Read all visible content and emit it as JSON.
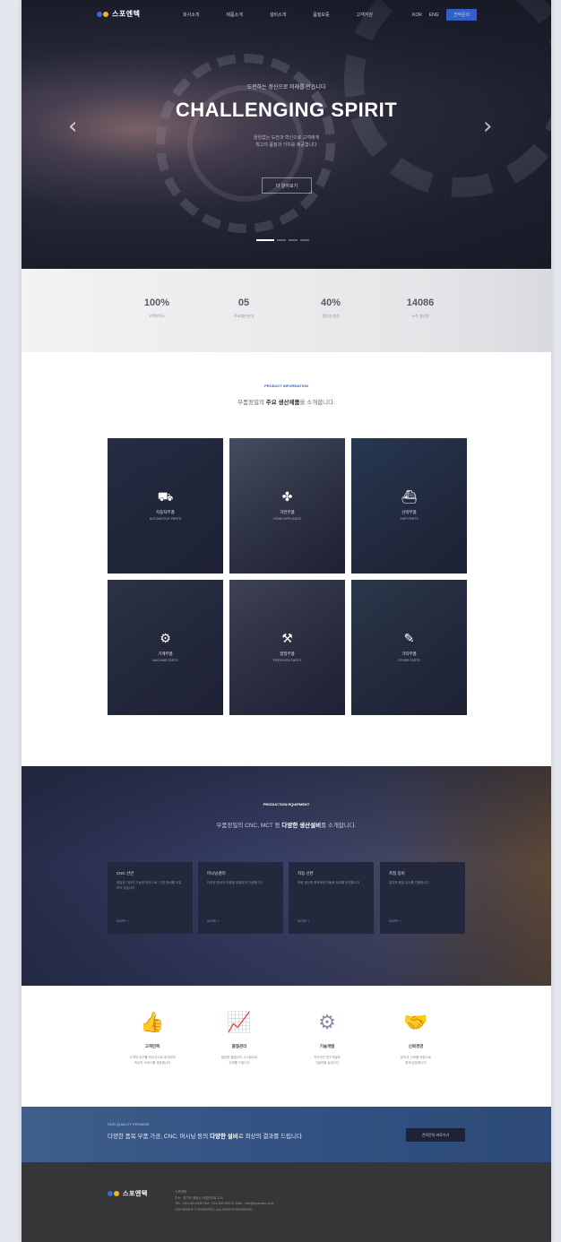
{
  "nav": {
    "logo_text": "스포엔텍",
    "menu": [
      "회사소개",
      "제품소개",
      "설비소개",
      "품질보증",
      "고객지원"
    ],
    "lang": "KOR",
    "lang_alt": "ENG",
    "cta_label": "견적문의"
  },
  "hero": {
    "subtitle": "도전하는 정신으로 미래를 만듭니다",
    "title": "CHALLENGING SPIRIT",
    "description_line1": "끊임없는 도전과 혁신으로 고객에게",
    "description_line2": "최고의 품질과 가치를 제공합니다",
    "button_label": "더 알아보기",
    "slide_count": 4,
    "active_slide": 1
  },
  "stats": [
    {
      "value": "100%",
      "label": "고객만족도"
    },
    {
      "value": "05",
      "label": "주요생산분야"
    },
    {
      "value": "40%",
      "label": "생산성 향상"
    },
    {
      "value": "14086",
      "label": "누적 생산량"
    }
  ],
  "products": {
    "eyebrow": "PRODUCT INFORMATION",
    "title_prefix": "부품정밀의 ",
    "title_bold": "주요 생산제품",
    "title_suffix": "을 소개합니다.",
    "items": [
      {
        "label": "자동차부품",
        "sub": "AUTOMOTIVE PARTS",
        "icon": "car-icon",
        "glyph": "⛟"
      },
      {
        "label": "가전부품",
        "sub": "HOME APPLIANCE",
        "icon": "appliance-icon",
        "glyph": "✤"
      },
      {
        "label": "선박부품",
        "sub": "SHIP PARTS",
        "icon": "ship-icon",
        "glyph": "⛴"
      },
      {
        "label": "기계부품",
        "sub": "MACHINE PARTS",
        "icon": "machine-icon",
        "glyph": "⚙"
      },
      {
        "label": "정밀부품",
        "sub": "PRECISION PARTS",
        "icon": "precision-icon",
        "glyph": "⚒"
      },
      {
        "label": "기타부품",
        "sub": "OTHER PARTS",
        "icon": "etc-icon",
        "glyph": "✎"
      }
    ],
    "colors": [
      "#2b3550",
      "#6a6f84",
      "#2e4a6a",
      "#3a3f57",
      "#5a5d6e",
      "#354a5e"
    ]
  },
  "equipment": {
    "eyebrow": "PRODUCTION EQUIPMENT",
    "title_prefix": "부품정밀의 CNC, MCT 등 ",
    "title_bold": "다양한 생산설비",
    "title_suffix": "를 소개합니다.",
    "cards": [
      {
        "title": "CNC 선반",
        "desc": "정밀한 가공이 가능한 최신 CNC 선반 장비를 보유하고 있습니다",
        "more": "MORE +"
      },
      {
        "title": "머시닝센터",
        "desc": "다양한 형상의 부품을 정밀하게 가공합니다",
        "more": "MORE +"
      },
      {
        "title": "자동 선반",
        "desc": "대량 생산에 최적화된 자동화 설비를 운영합니다",
        "more": "MORE +"
      },
      {
        "title": "측정 장비",
        "desc": "철저한 품질 검사를 진행합니다",
        "more": "MORE +"
      }
    ]
  },
  "features": [
    {
      "title": "고객만족",
      "desc1": "고객의 요구를 최우선으로 생각하며",
      "desc2": "최상의 서비스를 제공합니다",
      "icon": "thumbs-up-icon",
      "glyph": "👍",
      "color": "#6f8fb8"
    },
    {
      "title": "품질관리",
      "desc1": "철저한 품질관리 시스템으로",
      "desc2": "신뢰를 드립니다",
      "icon": "chart-icon",
      "glyph": "📈",
      "color": "#4b6ea8"
    },
    {
      "title": "기술개발",
      "desc1": "지속적인 연구개발로",
      "desc2": "기술력을 높입니다",
      "icon": "gear-badge-icon",
      "glyph": "⚙",
      "color": "#8a8fa8"
    },
    {
      "title": "신뢰경영",
      "desc1": "정직과 신뢰를 바탕으로",
      "desc2": "함께 성장합니다",
      "icon": "handshake-icon",
      "glyph": "🤝",
      "color": "#5f7aa8"
    }
  ],
  "cta": {
    "eyebrow": "OUR QUALITY PROMISE",
    "title_prefix": "다양한 품목 부품 가공, CNC, 머시닝 등의 ",
    "title_bold": "다양한 설비",
    "title_suffix": "로 최상의 결과를 드립니다",
    "button_label": "견적문의 바로가기"
  },
  "footer": {
    "logo_text": "스포엔텍",
    "lines": [
      "스포엔텍",
      "주소 : 경기도 화성시 산업단지로 123",
      "TEL : 031-000-0000  FAX : 031-000-0001  E-MAIL : info@spoentec.co.kr",
      "COPYRIGHT © SPOENTEC. ALL RIGHTS RESERVED."
    ]
  },
  "brand_colors": {
    "logo_dot1": "#2f6fd6",
    "logo_dot2": "#f2b41c",
    "accent": "#2f5fc7"
  }
}
